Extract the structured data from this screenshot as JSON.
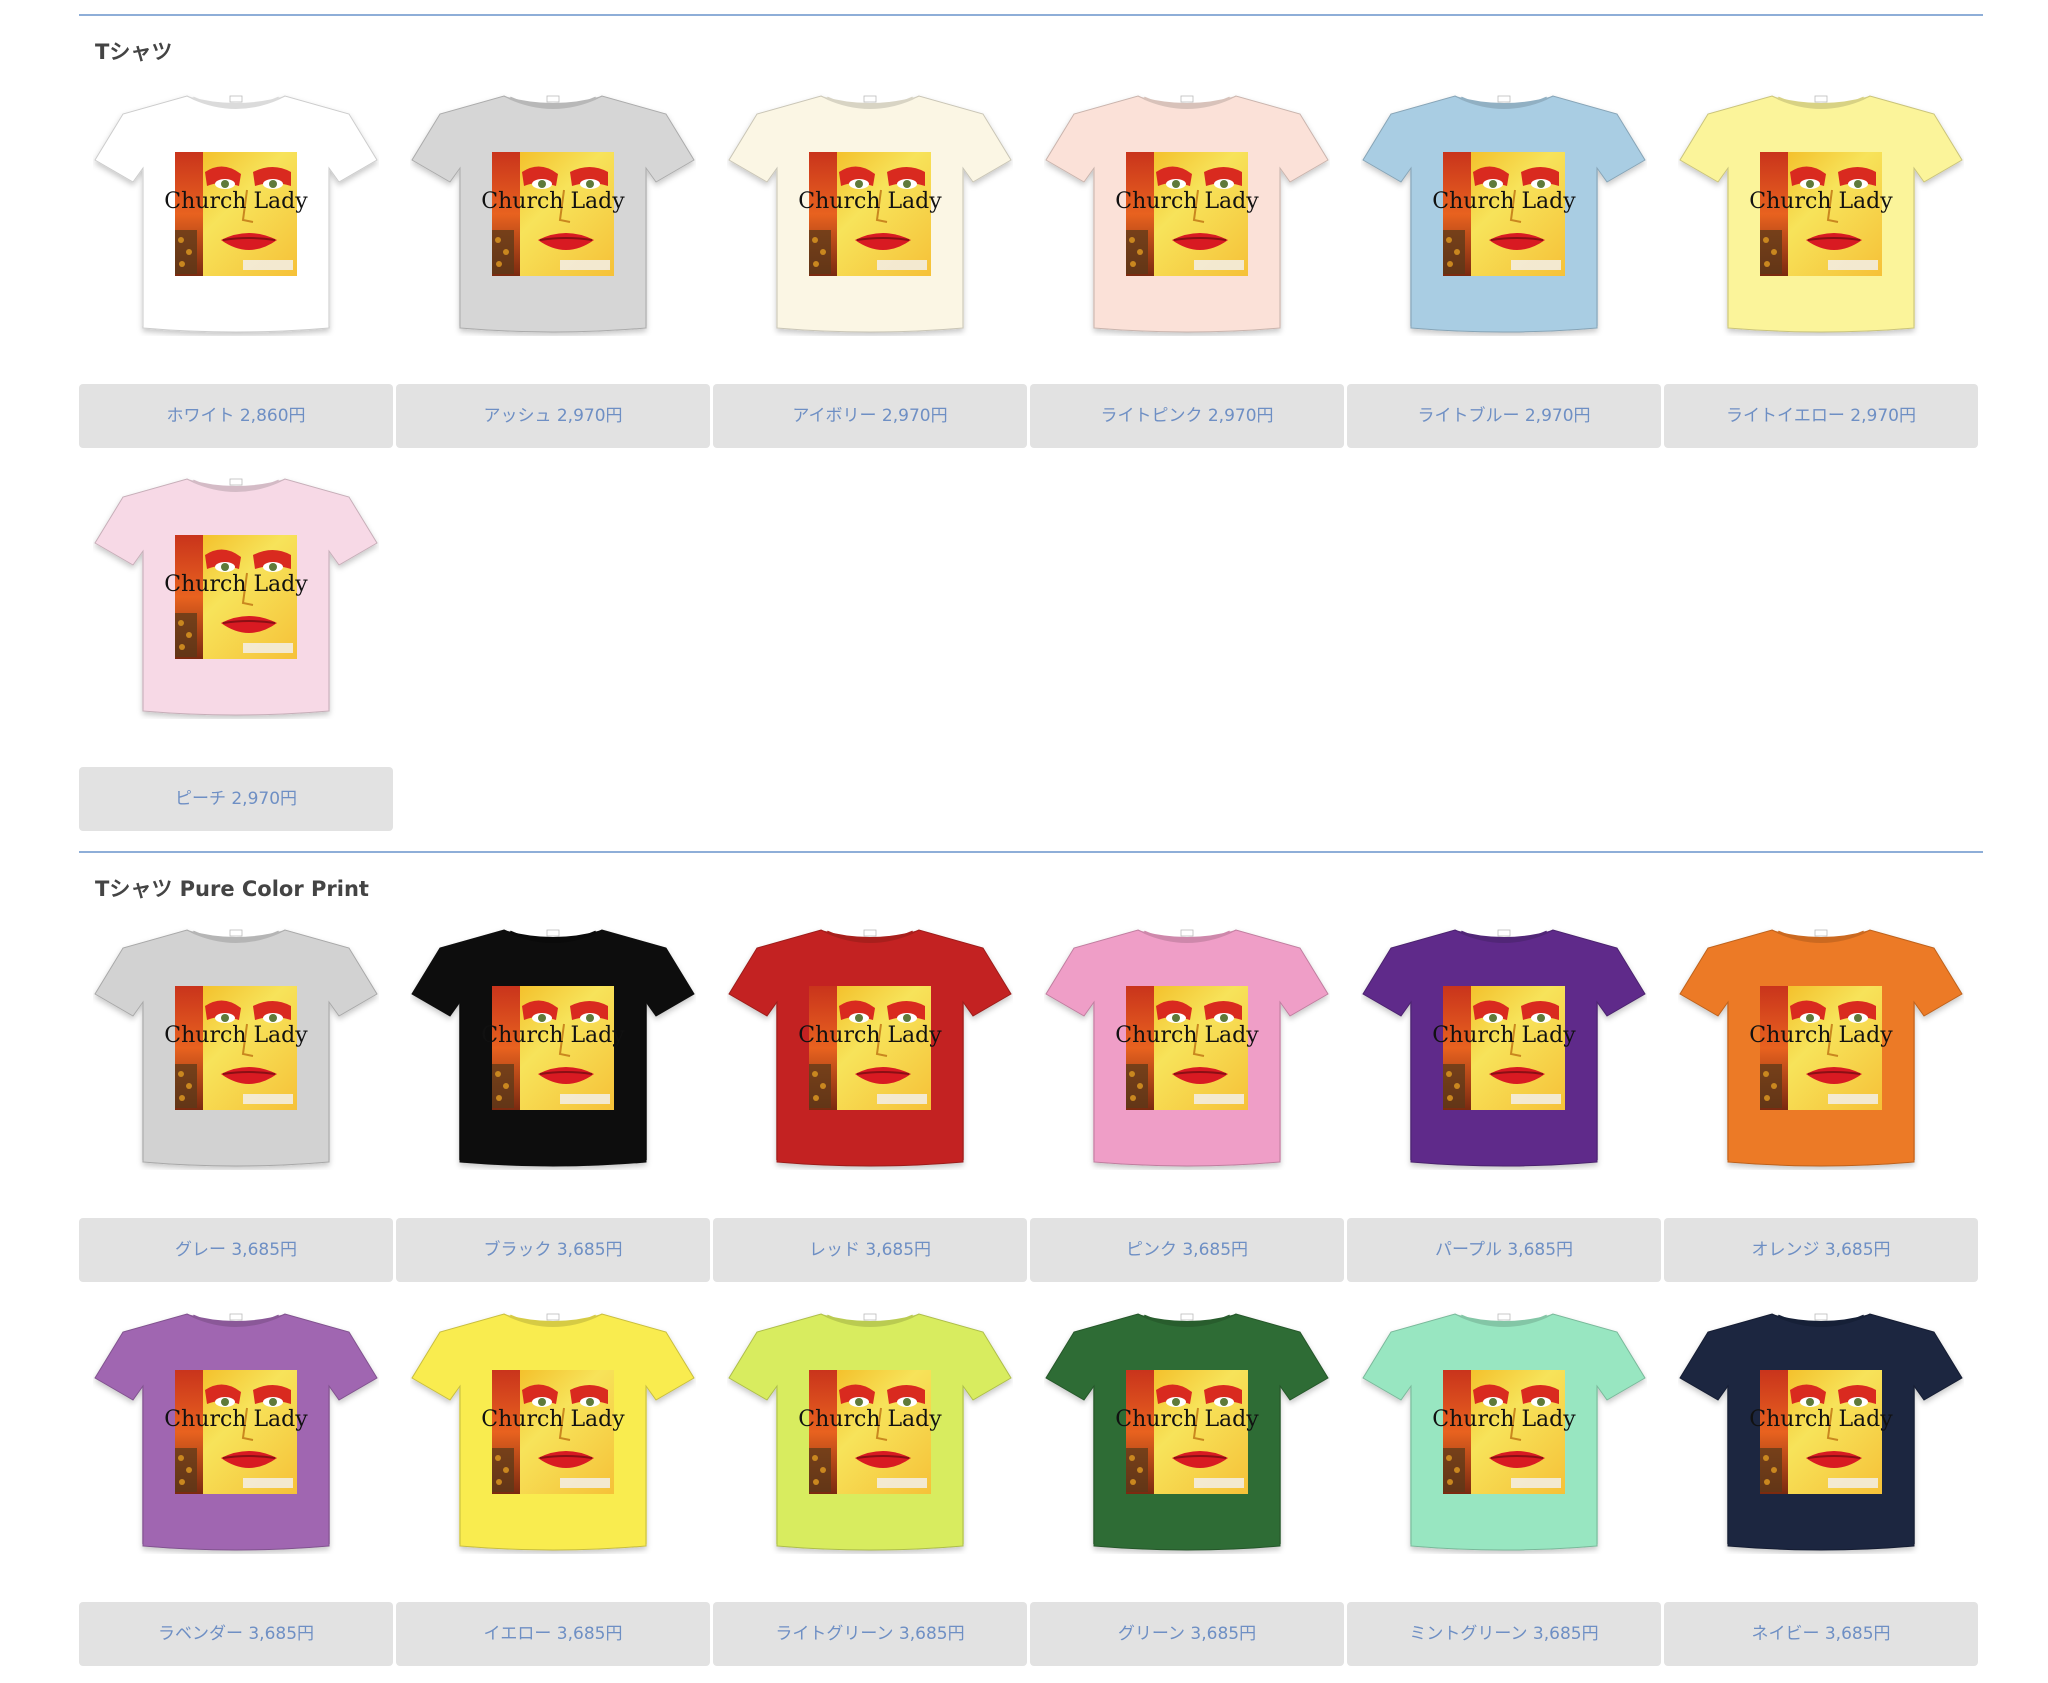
{
  "sections": [
    {
      "title": "Tシャツ",
      "items": [
        {
          "label": "ホワイト 2,860円",
          "color": "#ffffff"
        },
        {
          "label": "アッシュ 2,970円",
          "color": "#d6d6d6"
        },
        {
          "label": "アイボリー 2,970円",
          "color": "#fbf6e4"
        },
        {
          "label": "ライトピンク 2,970円",
          "color": "#fbe1d8"
        },
        {
          "label": "ライトブルー 2,970円",
          "color": "#a9cde3"
        },
        {
          "label": "ライトイエロー 2,970円",
          "color": "#fbf49a"
        },
        {
          "label": "ピーチ 2,970円",
          "color": "#f7d9e6"
        }
      ]
    },
    {
      "title": "Tシャツ Pure Color Print",
      "items": [
        {
          "label": "グレー 3,685円",
          "color": "#d2d2d2"
        },
        {
          "label": "ブラック 3,685円",
          "color": "#0c0c0c"
        },
        {
          "label": "レッド 3,685円",
          "color": "#c32421"
        },
        {
          "label": "ピンク 3,685円",
          "color": "#ef9ec7"
        },
        {
          "label": "パープル 3,685円",
          "color": "#5e2c8a"
        },
        {
          "label": "オレンジ 3,685円",
          "color": "#ec7a25"
        },
        {
          "label": "ラベンダー 3,685円",
          "color": "#a066b1"
        },
        {
          "label": "イエロー 3,685円",
          "color": "#f9ec4f"
        },
        {
          "label": "ライトグリーン 3,685円",
          "color": "#d8ec5e"
        },
        {
          "label": "グリーン 3,685円",
          "color": "#2e6c34"
        },
        {
          "label": "ミントグリーン 3,685円",
          "color": "#98e6c1"
        },
        {
          "label": "ネイビー 3,685円",
          "color": "#1a2540"
        }
      ]
    }
  ],
  "print_text": "Church Lady"
}
